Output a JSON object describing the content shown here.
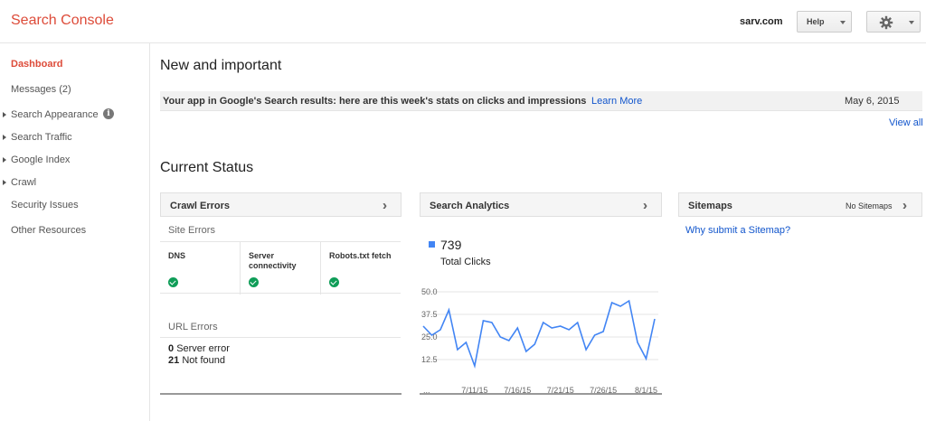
{
  "header": {
    "title": "Search Console",
    "site": "sarv.com",
    "help_label": "Help",
    "settings_icon": "gear-icon"
  },
  "sidebar": {
    "items": [
      {
        "label": "Dashboard",
        "active": true,
        "expandable": false
      },
      {
        "label": "Messages (2)",
        "active": false,
        "expandable": false
      },
      {
        "label": "Search Appearance",
        "active": false,
        "expandable": true,
        "info": true
      },
      {
        "label": "Search Traffic",
        "active": false,
        "expandable": true
      },
      {
        "label": "Google Index",
        "active": false,
        "expandable": true
      },
      {
        "label": "Crawl",
        "active": false,
        "expandable": true
      },
      {
        "label": "Security Issues",
        "active": false,
        "expandable": false
      },
      {
        "label": "Other Resources",
        "active": false,
        "expandable": false
      }
    ],
    "info_glyph": "i"
  },
  "main": {
    "new_important_title": "New and important",
    "notice": {
      "text": "Your app in Google's Search results: here are this week's stats on clicks and impressions",
      "link": "Learn More",
      "date": "May 6, 2015"
    },
    "view_all": "View all",
    "current_status_title": "Current Status",
    "crawl_errors": {
      "title": "Crawl Errors",
      "site_errors_label": "Site Errors",
      "columns": [
        {
          "label_lines": [
            "DNS"
          ],
          "status": "ok"
        },
        {
          "label_lines": [
            "Server",
            "connectivity"
          ],
          "status": "ok"
        },
        {
          "label_lines": [
            "Robots.txt fetch"
          ],
          "status": "ok"
        }
      ],
      "url_errors_label": "URL Errors",
      "url_errors": [
        {
          "count": "0",
          "label": "Server error"
        },
        {
          "count": "21",
          "label": "Not found"
        }
      ]
    },
    "search_analytics": {
      "title": "Search Analytics",
      "total": "739",
      "total_label": "Total Clicks"
    },
    "sitemaps": {
      "title": "Sitemaps",
      "status": "No Sitemaps",
      "link": "Why submit a Sitemap?"
    }
  },
  "chart_data": {
    "type": "line",
    "title": "",
    "xlabel": "",
    "ylabel": "",
    "y_ticks": [
      "50.0",
      "37.5",
      "25.0",
      "12.5"
    ],
    "ylim": [
      0,
      50
    ],
    "x_tick_labels": [
      "...",
      "7/11/15",
      "7/16/15",
      "7/21/15",
      "7/26/15",
      "8/1/15"
    ],
    "x_tick_index": [
      0,
      6,
      11,
      16,
      21,
      26
    ],
    "series": [
      {
        "name": "Total Clicks",
        "color": "#4285f4",
        "values": [
          31,
          26,
          29,
          40,
          18,
          22,
          9,
          34,
          33,
          25,
          23,
          30,
          17,
          21,
          33,
          30,
          31,
          29,
          33,
          18,
          26,
          28,
          44,
          42,
          45,
          22,
          13,
          35
        ]
      }
    ],
    "grid": true
  }
}
